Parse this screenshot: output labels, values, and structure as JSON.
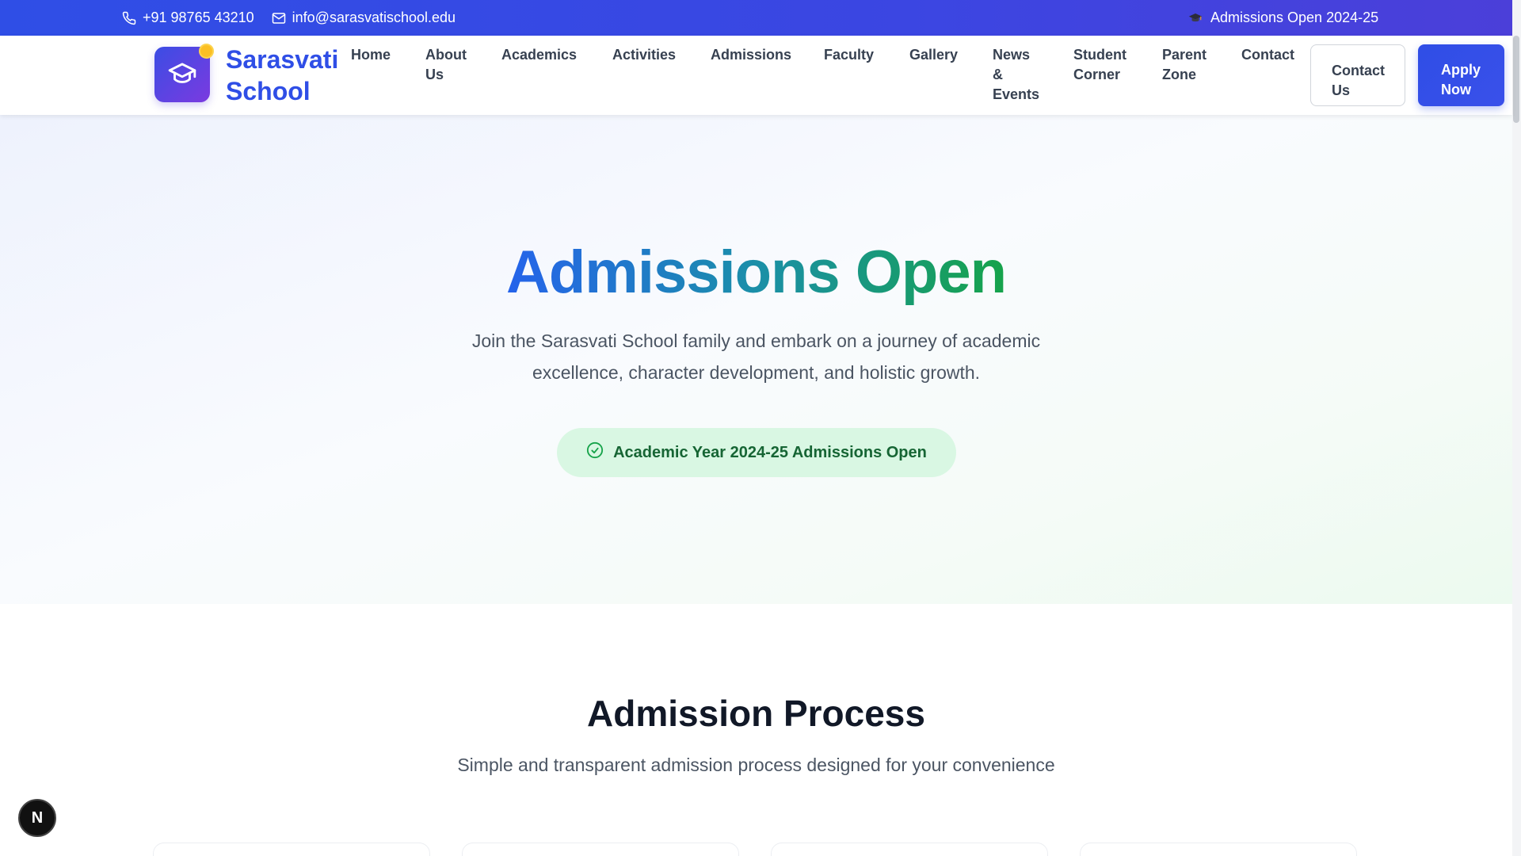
{
  "topbar": {
    "phone": "+91 98765 43210",
    "email": "info@sarasvatischool.edu",
    "announcement": "Admissions Open 2024-25",
    "icons": {
      "phone": "phone-icon",
      "email": "mail-icon",
      "announcement": "graduation-cap-icon"
    }
  },
  "header": {
    "brand_line1": "Sarasvati",
    "brand_line2": "School",
    "logo_icon": "graduation-cap-icon",
    "nav": [
      {
        "label": "Home"
      },
      {
        "label": "About Us"
      },
      {
        "label": "Academics"
      },
      {
        "label": "Activities"
      },
      {
        "label": "Admissions"
      },
      {
        "label": "Faculty"
      },
      {
        "label": "Gallery"
      },
      {
        "label": "News & Events"
      },
      {
        "label": "Student Corner"
      },
      {
        "label": "Parent Zone"
      },
      {
        "label": "Contact"
      }
    ],
    "contact_button": "Contact Us",
    "apply_button": "Apply Now"
  },
  "hero": {
    "title": "Admissions Open",
    "subtitle": "Join the Sarasvati School family and embark on a journey of academic excellence, character development, and holistic growth.",
    "badge": "Academic Year 2024-25 Admissions Open",
    "badge_icon": "check-circle-icon"
  },
  "process": {
    "title": "Admission Process",
    "subtitle": "Simple and transparent admission process designed for your convenience"
  },
  "floating_button": {
    "label": "N"
  },
  "colors": {
    "primary": "#2f4ee6",
    "accent_purple": "#7b3ae0",
    "green": "#16a34a",
    "badge_bg": "#d9f7e3"
  }
}
